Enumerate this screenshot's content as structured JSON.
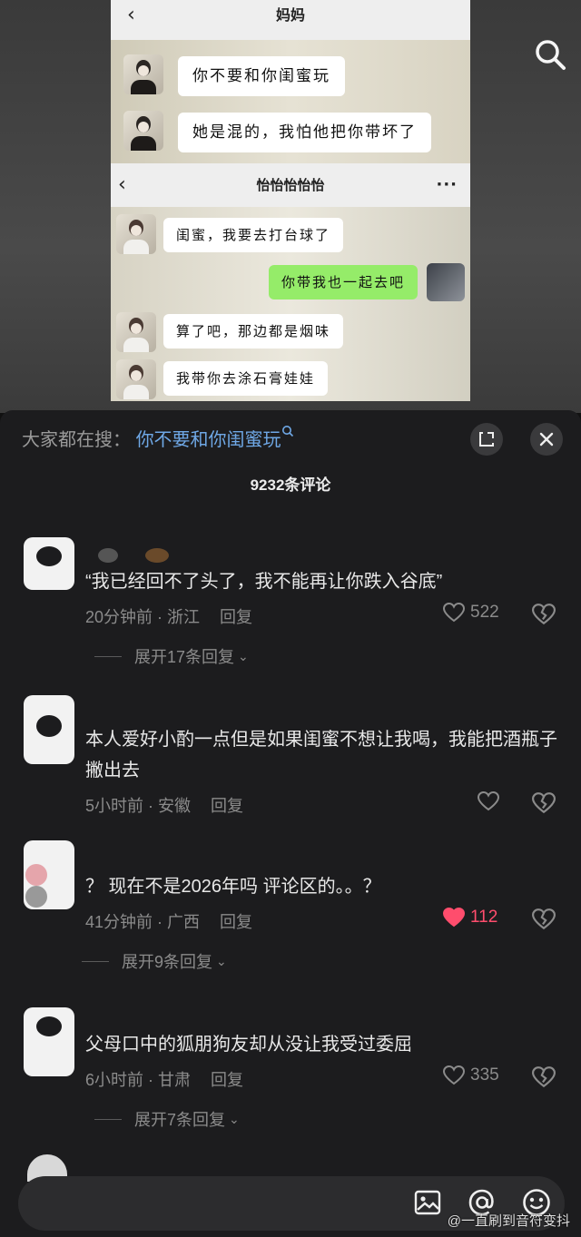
{
  "video": {
    "chat1": {
      "title": "妈妈",
      "messages": [
        "你不要和你闺蜜玩",
        "她是混的，我怕他把你带坏了"
      ]
    },
    "chat2": {
      "title": "怡怡怡怡怡",
      "more": "···",
      "messages": [
        {
          "from": "friend",
          "text": "闺蜜，我要去打台球了"
        },
        {
          "from": "me",
          "text": "你带我也一起去吧"
        },
        {
          "from": "friend",
          "text": "算了吧，那边都是烟味"
        },
        {
          "from": "friend",
          "text": "我带你去涂石膏娃娃"
        }
      ]
    },
    "back_glyph": "‹",
    "search_icon": "search-icon"
  },
  "sheet": {
    "hot_search_prefix": "大家都在搜：",
    "hot_search_query": "你不要和你闺蜜玩",
    "comment_count": "9232条评论",
    "comments": [
      {
        "text": "“我已经回不了头了，我不能再让你跌入谷底”",
        "time": "20分钟前",
        "loc": "浙江",
        "reply": "回复",
        "likes": "522",
        "liked": false,
        "expand": "展开17条回复"
      },
      {
        "text": "本人爱好小酌一点但是如果闺蜜不想让我喝，我能把酒瓶子撇出去",
        "time": "5小时前",
        "loc": "安徽",
        "reply": "回复",
        "likes": "",
        "liked": false
      },
      {
        "text": "？ 现在不是2026年吗 评论区的。。？",
        "time": "41分钟前",
        "loc": "广西",
        "reply": "回复",
        "likes": "112",
        "liked": true,
        "expand": "展开9条回复"
      },
      {
        "text": "父母口中的狐朋狗友却从没让我受过委屈",
        "time": "6小时前",
        "loc": "甘肃",
        "reply": "回复",
        "likes": "335",
        "liked": false,
        "expand": "展开7条回复"
      }
    ],
    "icons": [
      "expand-icon",
      "close-icon",
      "heart-icon",
      "dislike-icon",
      "chevron-down-icon",
      "image-icon",
      "at-icon",
      "emoji-icon"
    ],
    "accent_color": "#6fa8e6",
    "liked_color": "#ff4d6d"
  },
  "watermark": "@一直刷到音符变抖"
}
